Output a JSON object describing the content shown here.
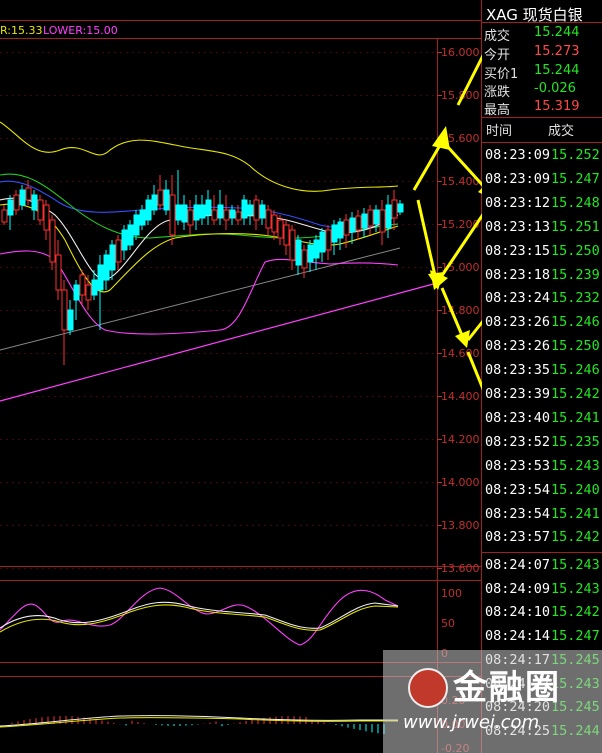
{
  "header": {
    "left_label": "R:15.33",
    "lower_label": "LOWER:15.00"
  },
  "price_axis": [
    "16.000",
    "15.800",
    "15.600",
    "15.400",
    "15.200",
    "15.000",
    "14.800",
    "14.600",
    "14.400",
    "14.200",
    "14.000",
    "13.800",
    "13.600"
  ],
  "osc_axis": [
    "100",
    "50",
    "0"
  ],
  "macd_axis": [
    "0.20",
    "0.00",
    "-0.20"
  ],
  "quote": {
    "title": "XAG  现货白银",
    "rows": [
      {
        "label": "成交",
        "value": "15.244",
        "color": "#22e622"
      },
      {
        "label": "今开",
        "value": "15.273",
        "color": "#ff4a4a"
      },
      {
        "label": "买价1",
        "value": "15.244",
        "color": "#22e622"
      },
      {
        "label": "涨跌",
        "value": "-0.026",
        "color": "#22e622"
      },
      {
        "label": "最高",
        "value": "15.319",
        "color": "#ff4a4a"
      }
    ],
    "col_time": "时间",
    "col_price": "成交"
  },
  "ticks": [
    {
      "time": "08:23:09",
      "price": "15.252"
    },
    {
      "time": "08:23:09",
      "price": "15.247"
    },
    {
      "time": "08:23:12",
      "price": "15.248"
    },
    {
      "time": "08:23:13",
      "price": "15.251"
    },
    {
      "time": "08:23:15",
      "price": "15.250"
    },
    {
      "time": "08:23:18",
      "price": "15.239"
    },
    {
      "time": "08:23:24",
      "price": "15.232"
    },
    {
      "time": "08:23:26",
      "price": "15.246"
    },
    {
      "time": "08:23:26",
      "price": "15.250"
    },
    {
      "time": "08:23:35",
      "price": "15.246"
    },
    {
      "time": "08:23:39",
      "price": "15.242"
    },
    {
      "time": "08:23:40",
      "price": "15.241"
    },
    {
      "time": "08:23:52",
      "price": "15.235"
    },
    {
      "time": "08:23:53",
      "price": "15.243"
    },
    {
      "time": "08:23:54",
      "price": "15.240"
    },
    {
      "time": "08:23:54",
      "price": "15.241"
    },
    {
      "time": "08:23:57",
      "price": "15.242"
    },
    {
      "time": "08:24:07",
      "price": "15.243"
    },
    {
      "time": "08:24:09",
      "price": "15.243"
    },
    {
      "time": "08:24:10",
      "price": "15.242"
    },
    {
      "time": "08:24:14",
      "price": "15.247"
    },
    {
      "time": "08:24:17",
      "price": "15.245"
    },
    {
      "time": "08:24:17",
      "price": "15.243"
    },
    {
      "time": "08:24:20",
      "price": "15.245"
    },
    {
      "time": "08:24:25",
      "price": "15.244"
    }
  ],
  "watermark": {
    "name": "金融圈",
    "url": "www.jrwei.com"
  },
  "colors": {
    "up": "#ff3030",
    "down": "#00ffff",
    "green": "#22e622",
    "axis": "#c03030",
    "annotation": "#ffff00"
  }
}
